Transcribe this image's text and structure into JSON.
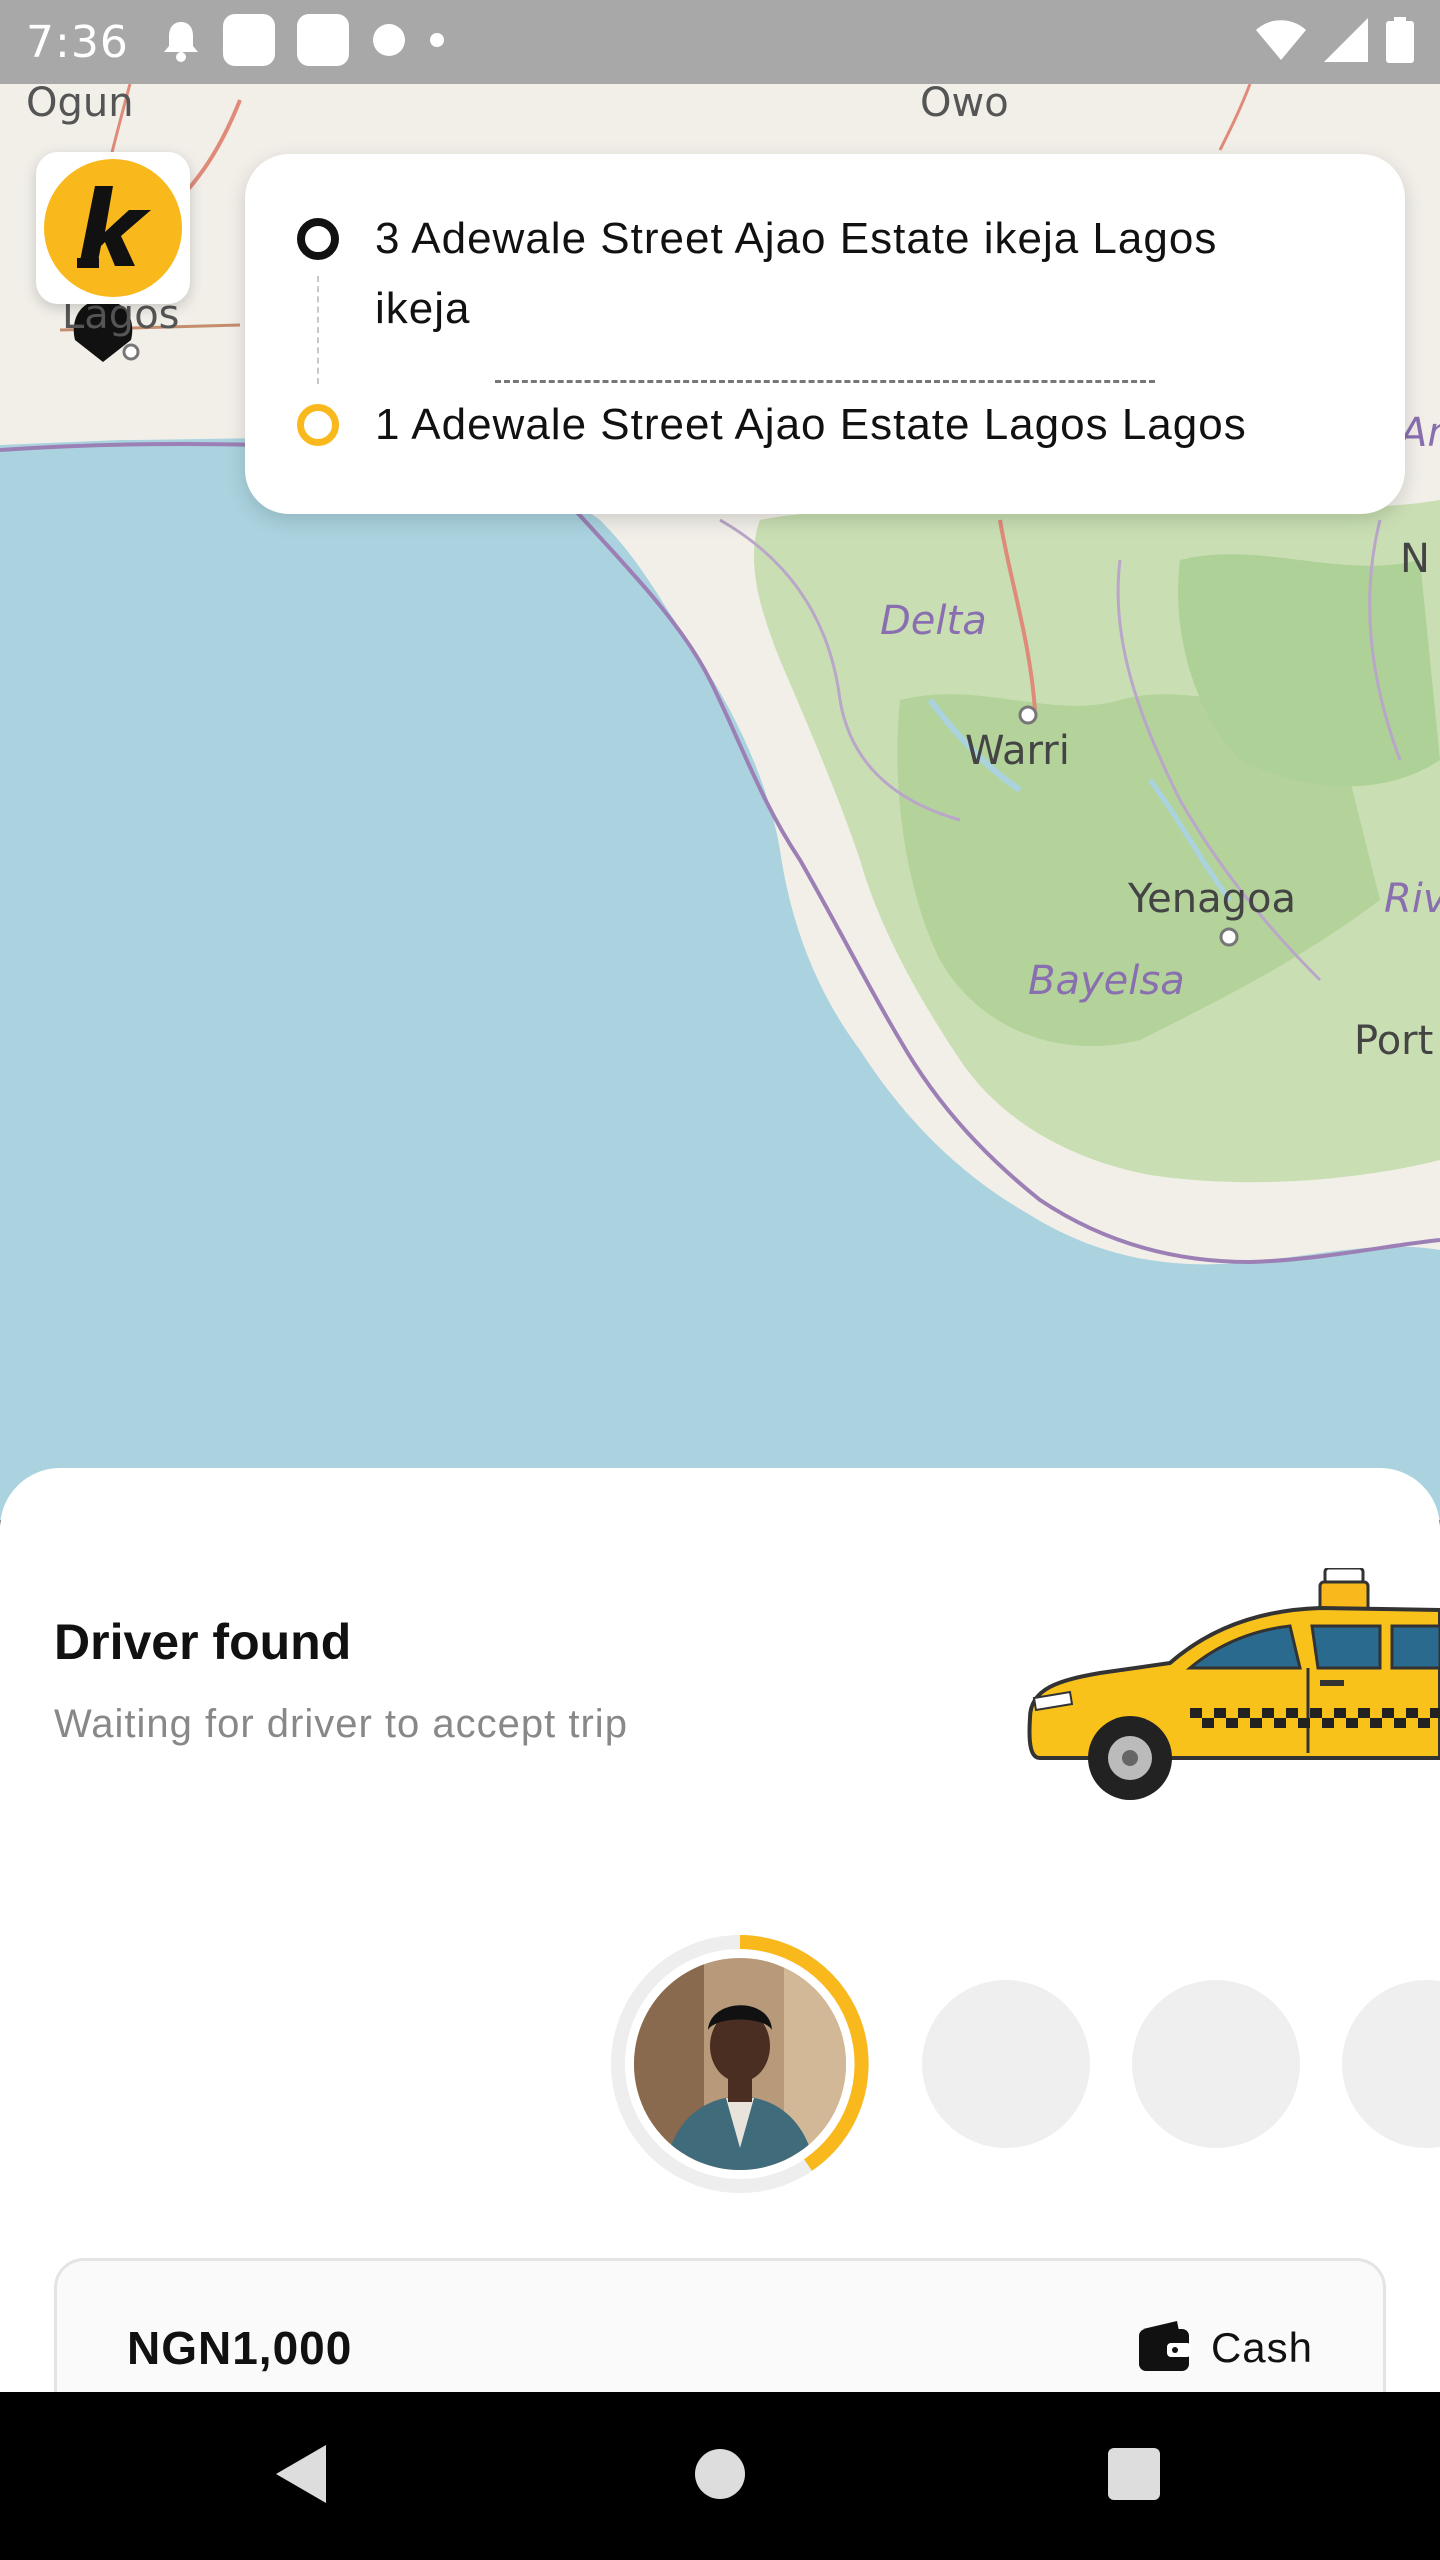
{
  "status_bar": {
    "time": "7:36"
  },
  "map": {
    "labels": {
      "ogun": "Ogun",
      "owo": "Owo",
      "lagos": "Lagos",
      "delta": "Delta",
      "warri": "Warri",
      "yenagoa": "Yenagoa",
      "bayelsa": "Bayelsa",
      "rivers": "Riv",
      "port": "Port",
      "n": "N",
      "an": "An"
    }
  },
  "trip": {
    "pickup_address": "3 Adewale Street Ajao Estate ikeja Lagos ikeja",
    "destination_address": "1 Adewale Street Ajao Estate Lagos Lagos"
  },
  "sheet": {
    "title": "Driver found",
    "subtitle": "Waiting for driver to accept trip"
  },
  "fare": {
    "amount": "NGN1,000",
    "payment_method": "Cash"
  },
  "colors": {
    "brand_yellow": "#f9b81b",
    "map_water": "#aad3df",
    "map_land": "#f2efe9"
  },
  "icons": {
    "logo": "k-brand-logo",
    "pickup": "circle-outline-icon",
    "destination": "circle-outline-yellow-icon",
    "payment": "wallet-icon",
    "nav_back": "back-triangle-icon",
    "nav_home": "home-circle-icon",
    "nav_recents": "recents-square-icon"
  }
}
